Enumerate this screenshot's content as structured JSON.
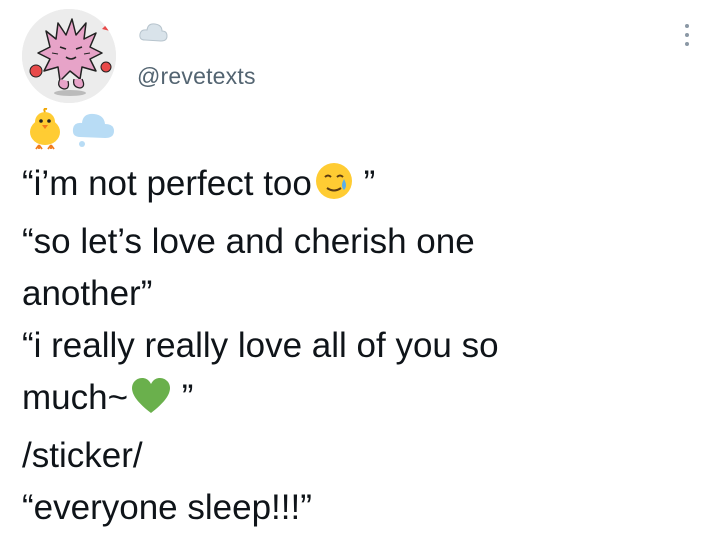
{
  "user": {
    "handle": "@revetexts"
  },
  "tweet": {
    "line1": "“i’m not perfect too",
    "line1_close": " ”",
    "line2": "“so let’s love and cherish one",
    "line3": "another”",
    "line4": "“i really really love all of you so",
    "line5": "much~",
    "line5_close": " ”",
    "line6": "/sticker/",
    "line7": "“everyone sleep!!!”"
  },
  "icons": {
    "header_emoji": "cloud",
    "row_emojis": [
      "baby-chick",
      "cloud"
    ],
    "line1_emoji": "sad-but-relieved-face",
    "line5_emoji": "green-heart",
    "menu": "more-vertical"
  },
  "colors": {
    "text": "#0f1419",
    "handle": "#536471",
    "menu": "#8b98a5",
    "avatar_pink": "#e7a3c8",
    "heart_green": "#6ab04c",
    "emoji_yellow": "#ffcc33",
    "cloud_blue": "#b8dcf5"
  }
}
